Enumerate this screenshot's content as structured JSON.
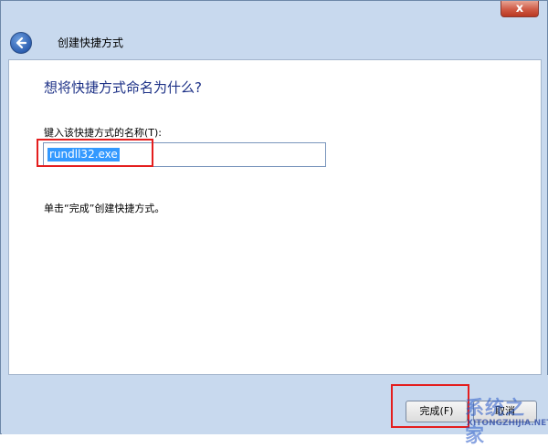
{
  "window": {
    "close_label": "x"
  },
  "nav": {
    "title": "创建快捷方式"
  },
  "main": {
    "heading": "想将快捷方式命名为什么?",
    "field_label": "键入该快捷方式的名称(T):",
    "name_value": "rundll32.exe",
    "hint": "单击“完成”创建快捷方式。"
  },
  "footer": {
    "finish_label": "完成(F)",
    "cancel_label": "取消"
  },
  "watermark": {
    "text": "系统之家",
    "url": "XITONGZHIJIA.NET"
  },
  "colors": {
    "frame": "#c8d9ee",
    "heading": "#1e3287",
    "highlight": "#e41e1e",
    "selection": "#3399ff"
  }
}
